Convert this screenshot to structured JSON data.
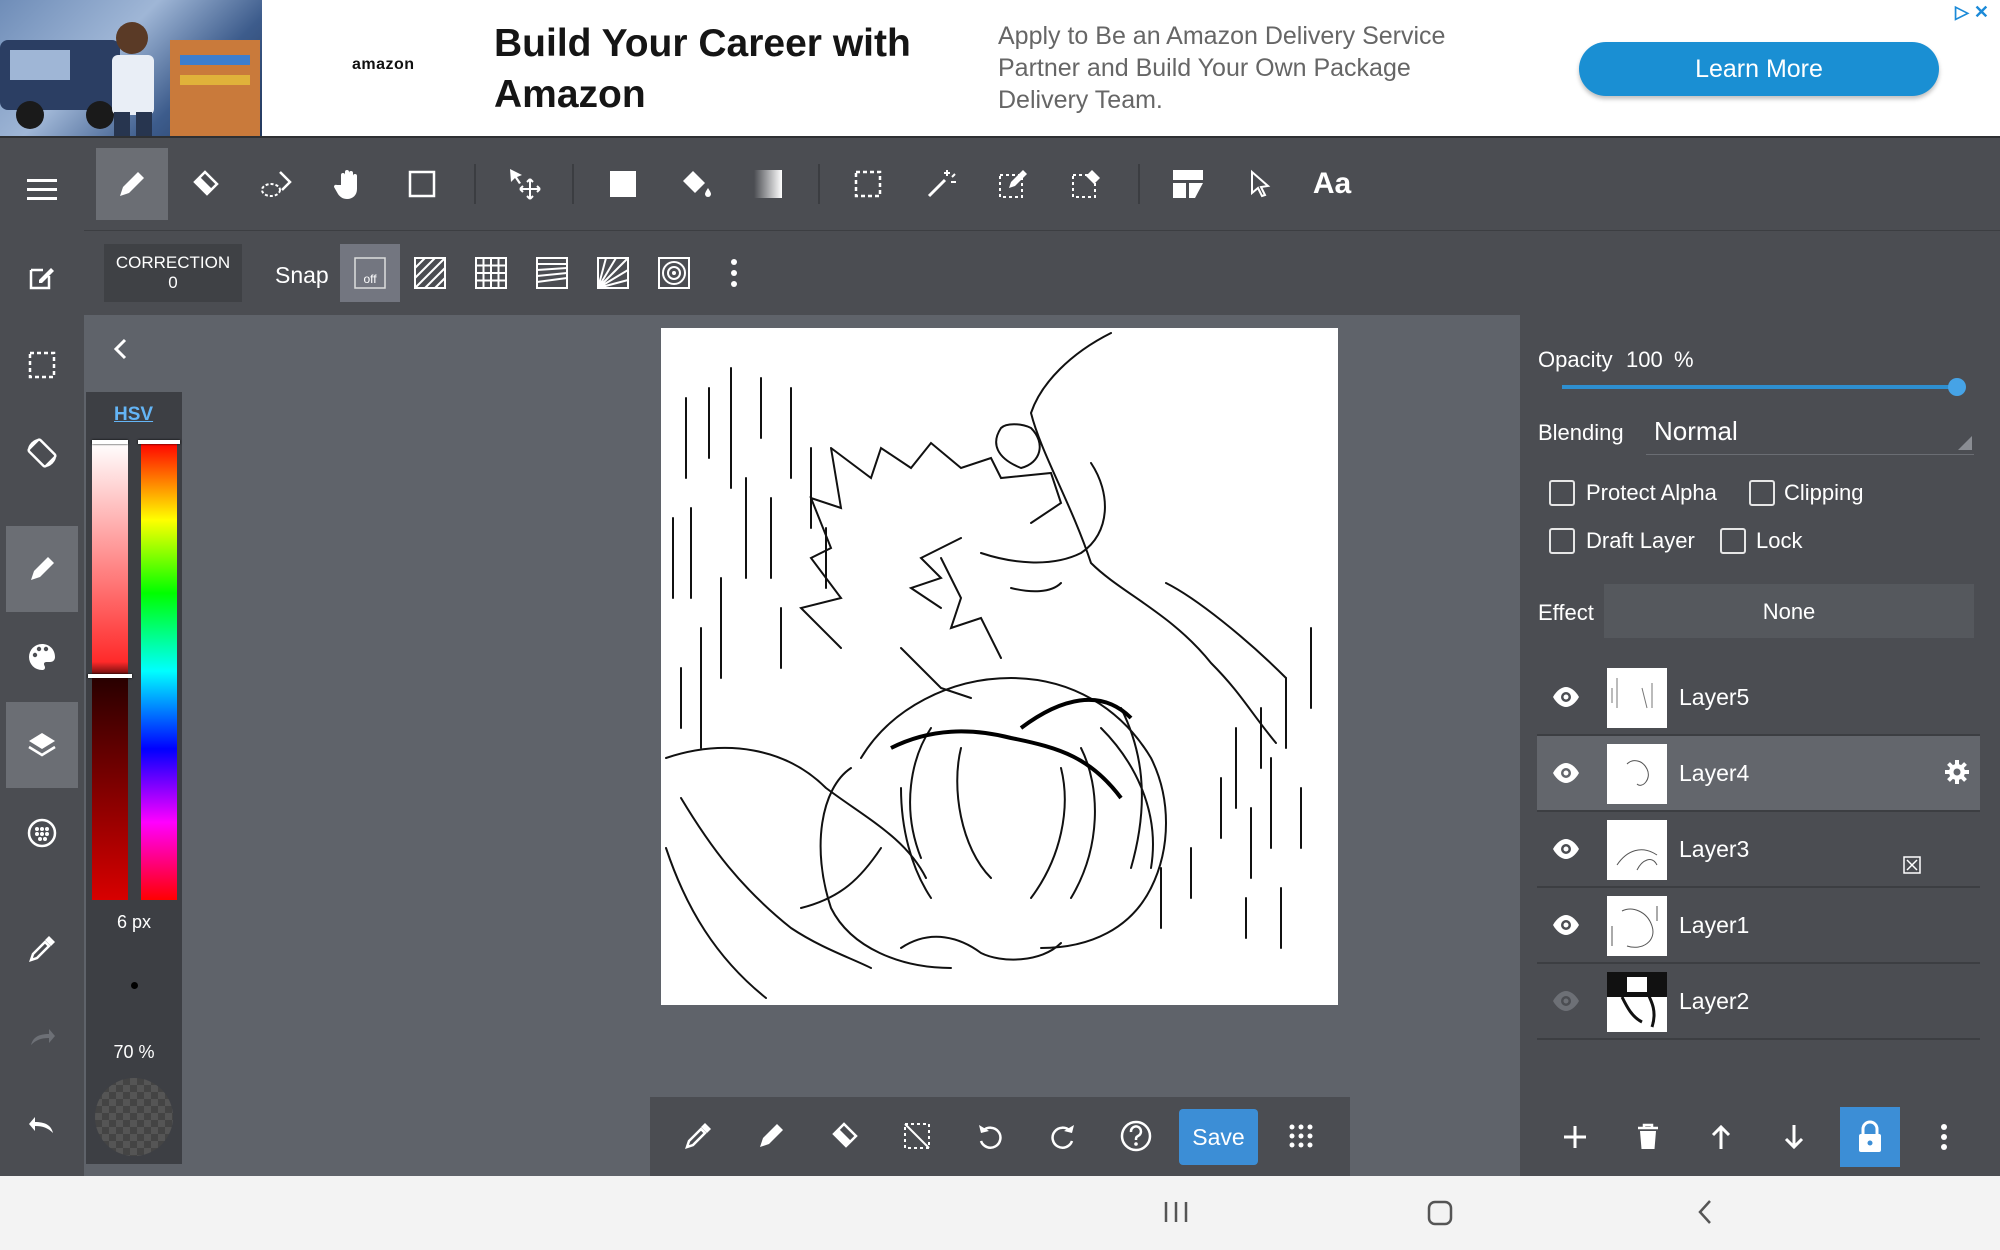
{
  "ad": {
    "logo": "amazon",
    "headline": "Build Your Career with Amazon",
    "body": "Apply to Be an Amazon Delivery Service Partner and Build Your Own Package Delivery Team.",
    "cta": "Learn More"
  },
  "toolbar": {
    "tools": [
      "pen-icon",
      "eraser-icon",
      "blur-icon",
      "hand-icon",
      "shape-icon",
      "move-icon",
      "fill-rect-icon",
      "bucket-icon",
      "gradient-icon",
      "select-icon",
      "magic-wand-icon",
      "select-pen-icon",
      "select-eraser-icon",
      "frame-icon",
      "cursor-icon",
      "text-icon"
    ],
    "text_tool_label": "Aa"
  },
  "subtoolbar": {
    "correction_label": "CORRECTION",
    "correction_value": "0",
    "snap_label": "Snap",
    "snap_off_label": "off"
  },
  "color_panel": {
    "mode_tab": "HSV",
    "brush_size": "6 px",
    "brush_opacity": "70 %"
  },
  "layer_panel": {
    "opacity_label": "Opacity",
    "opacity_value": "100",
    "opacity_unit": "%",
    "opacity_fraction": 1.0,
    "blending_label": "Blending",
    "blending_value": "Normal",
    "protect_alpha": "Protect Alpha",
    "clipping": "Clipping",
    "draft_layer": "Draft Layer",
    "lock": "Lock",
    "effect_label": "Effect",
    "effect_value": "None",
    "layers": [
      {
        "name": "Layer5",
        "visible": true
      },
      {
        "name": "Layer4",
        "visible": true,
        "selected": true
      },
      {
        "name": "Layer3",
        "visible": true
      },
      {
        "name": "Layer1",
        "visible": true
      },
      {
        "name": "Layer2",
        "visible": false
      }
    ]
  },
  "bottom_bar": {
    "save_label": "Save"
  },
  "colors": {
    "accent": "#3c8ed6",
    "panel": "#4b4d52",
    "background": "#5f636a"
  }
}
